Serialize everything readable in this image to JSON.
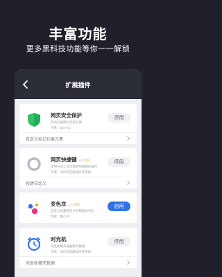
{
  "hero": {
    "title": "丰富功能",
    "subtitle": "更多黑科技功能等你一一解锁"
  },
  "phone": {
    "title": "扩展插件"
  },
  "plugins": [
    {
      "name": "网页安全保护",
      "version": "",
      "desc": "有效拦截网页风险元素",
      "author": "作者：Derma",
      "button": "停用",
      "footer": "自定义标记拦截元素",
      "icon": "shield-icon",
      "icon_color": "#2ec566"
    },
    {
      "name": "网页快捷键",
      "version": "v1.2000",
      "desc": "使用方式上显示键盘快捷键的插件",
      "author": "作者：360浏览器插件开发组",
      "button": "停用",
      "footer": "按键自定义",
      "icon": "ring-icon",
      "icon_color": "#b8bcc4"
    },
    {
      "name": "变色龙",
      "version": "v1.2000",
      "desc": "自定义设置网页中控制颜色色彩",
      "author": "作者：媚小诗",
      "button": "启用",
      "footer": "",
      "icon": "color-dots-icon",
      "icon_color": "#2f72e6"
    },
    {
      "name": "时光机",
      "version": "",
      "desc": "恢复收藏夹被删除的数据",
      "author": "作者：360浏览器插件开发组",
      "button": "停用",
      "footer": "恢复收藏夹数据",
      "icon": "alarm-clock-icon",
      "icon_color": "#2f72e6"
    }
  ],
  "colors": {
    "background": "#1f2029",
    "header": "#2c2e37",
    "accent": "#2f72e6"
  }
}
